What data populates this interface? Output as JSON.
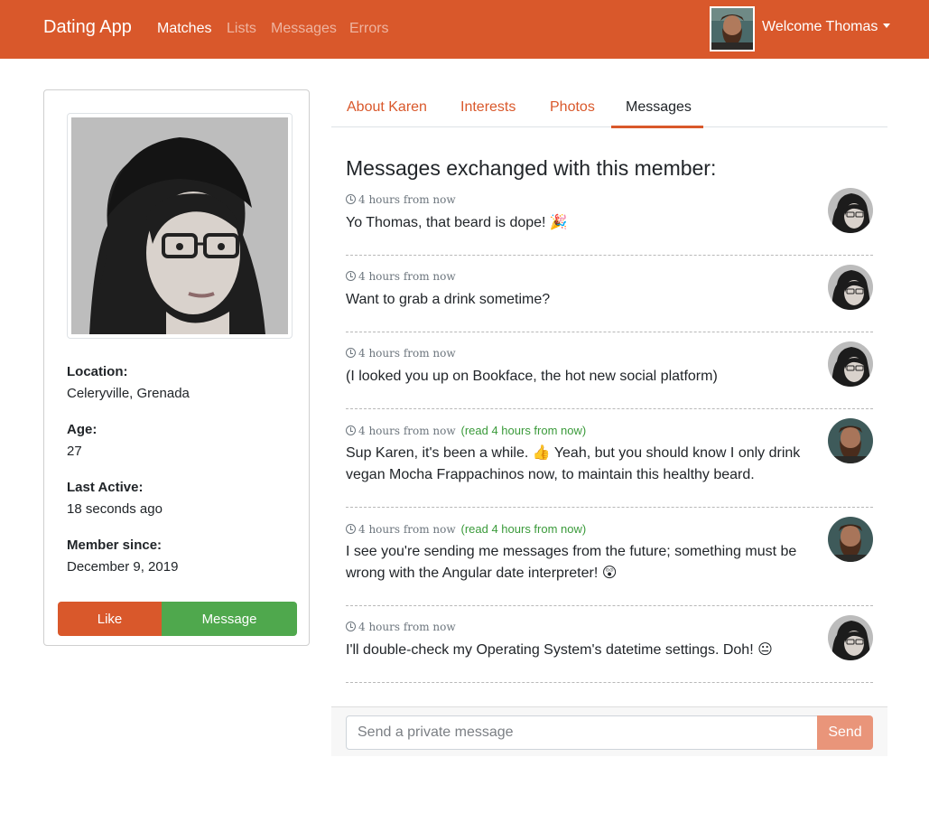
{
  "navbar": {
    "brand": "Dating App",
    "links": [
      "Matches",
      "Lists",
      "Messages",
      "Errors"
    ],
    "active_link": "Matches",
    "welcome": "Welcome Thomas",
    "avatar_icon": "user-avatar-thomas"
  },
  "profile": {
    "photo_icon": "member-photo-karen",
    "location_label": "Location:",
    "location": "Celeryville, Grenada",
    "age_label": "Age:",
    "age": "27",
    "last_active_label": "Last Active:",
    "last_active": "18 seconds ago",
    "member_since_label": "Member since:",
    "member_since": "December 9, 2019",
    "like_label": "Like",
    "message_label": "Message"
  },
  "tabs": [
    "About Karen",
    "Interests",
    "Photos",
    "Messages"
  ],
  "active_tab": "Messages",
  "messages_title": "Messages exchanged with this member:",
  "messages": [
    {
      "time": "4 hours from now",
      "read": "",
      "text": "Yo Thomas, that beard is dope! 🎉",
      "sender": "Karen"
    },
    {
      "time": "4 hours from now",
      "read": "",
      "text": "Want to grab a drink sometime?",
      "sender": "Karen"
    },
    {
      "time": "4 hours from now",
      "read": "",
      "text": "(I looked you up on Bookface, the hot new social platform)",
      "sender": "Karen"
    },
    {
      "time": "4 hours from now",
      "read": "(read 4 hours from now)",
      "text": "Sup Karen, it's been a while. 👍 Yeah, but you should know I only drink vegan Mocha Frappachinos now, to maintain this healthy beard.",
      "sender": "Thomas"
    },
    {
      "time": "4 hours from now",
      "read": "(read 4 hours from now)",
      "text": "I see you're sending me messages from the future; something must be wrong with the Angular date interpreter! 😲",
      "sender": "Thomas"
    },
    {
      "time": "4 hours from now",
      "read": "",
      "text": "I'll double-check my Operating System's datetime settings. Doh! 😐",
      "sender": "Karen"
    }
  ],
  "composer": {
    "placeholder": "Send a private message",
    "send_label": "Send"
  },
  "colors": {
    "primary": "#d9582b",
    "success": "#4fa84d",
    "read_status": "#3a9a3a"
  }
}
